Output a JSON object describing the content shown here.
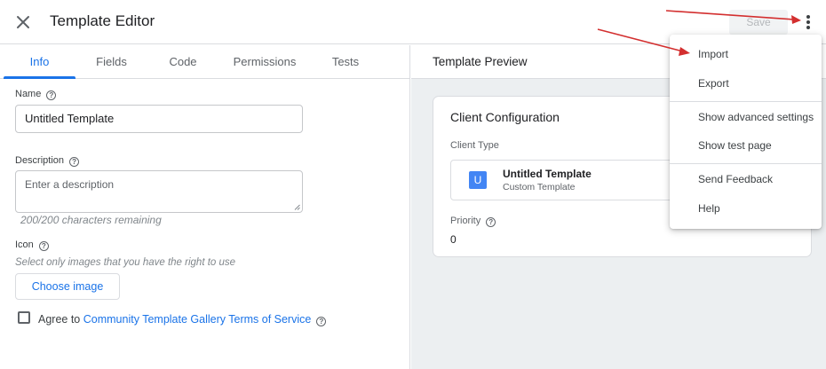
{
  "header": {
    "title": "Template Editor",
    "save_label": "Save"
  },
  "tabs": [
    {
      "label": "Info"
    },
    {
      "label": "Fields"
    },
    {
      "label": "Code"
    },
    {
      "label": "Permissions"
    },
    {
      "label": "Tests"
    }
  ],
  "info": {
    "name_label": "Name",
    "name_value": "Untitled Template",
    "description_label": "Description",
    "description_placeholder": "Enter a description",
    "chars_remaining": "200/200 characters remaining",
    "icon_label": "Icon",
    "icon_hint": "Select only images that you have the right to use",
    "choose_image_label": "Choose image",
    "agree_prefix": "Agree to",
    "agree_link": "Community Template Gallery Terms of Service"
  },
  "preview": {
    "title": "Template Preview",
    "card_title": "Client Configuration",
    "client_type_label": "Client Type",
    "type_icon_letter": "U",
    "type_name": "Untitled Template",
    "type_sub": "Custom Template",
    "priority_label": "Priority",
    "priority_value": "0"
  },
  "menu": {
    "items": [
      {
        "label": "Import"
      },
      {
        "label": "Export"
      },
      {
        "label": "Show advanced settings"
      },
      {
        "label": "Show test page"
      },
      {
        "label": "Send Feedback"
      },
      {
        "label": "Help"
      }
    ]
  },
  "colors": {
    "accent": "#1a73e8",
    "annotation_arrow": "#d32f2f",
    "type_icon": "#4285f4"
  },
  "icons": {
    "close": "close-icon",
    "more": "more-vert-icon",
    "help": "help-circle-icon"
  }
}
